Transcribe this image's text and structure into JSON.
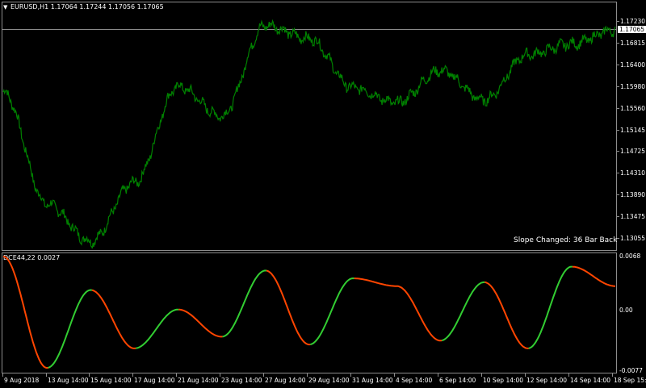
{
  "symbol_header": {
    "arrow": "▼",
    "text": "EURUSD,H1  1.17064 1.17244 1.17056 1.17065"
  },
  "current_price": "1.17065",
  "price_axis": [
    "1.17230",
    "1.16815",
    "1.16400",
    "1.15980",
    "1.15560",
    "1.15145",
    "1.14725",
    "1.14310",
    "1.13890",
    "1.13475",
    "1.13055"
  ],
  "annotation": "Slope Changed: 36 Bar Back",
  "indicator": {
    "header": "DCE44,22 0.0027",
    "axis": [
      "0.0068",
      "0.00",
      "-0.0077"
    ],
    "colors": {
      "rising": "#32cd32",
      "falling": "#ff4500"
    }
  },
  "time_axis": [
    "9 Aug 2018",
    "13 Aug 14:00",
    "15 Aug 14:00",
    "17 Aug 14:00",
    "21 Aug 14:00",
    "23 Aug 14:00",
    "27 Aug 14:00",
    "29 Aug 14:00",
    "31 Aug 14:00",
    "4 Sep 14:00",
    "6 Sep 14:00",
    "10 Sep 14:00",
    "12 Sep 14:00",
    "14 Sep 14:00",
    "18 Sep 15:00"
  ],
  "colors": {
    "price_line": "#008000",
    "background": "#000000",
    "grid": "#8c8c8c"
  },
  "chart_data": {
    "type": "line",
    "symbol": "EURUSD",
    "timeframe": "H1",
    "x": [
      "9 Aug 2018",
      "13 Aug 14:00",
      "15 Aug 14:00",
      "17 Aug 14:00",
      "21 Aug 14:00",
      "23 Aug 14:00",
      "27 Aug 14:00",
      "29 Aug 14:00",
      "31 Aug 14:00",
      "4 Sep 14:00",
      "6 Sep 14:00",
      "10 Sep 14:00",
      "12 Sep 14:00",
      "14 Sep 14:00",
      "18 Sep 15:00"
    ],
    "series": [
      {
        "name": "EURUSD",
        "values": [
          1.159,
          1.138,
          1.131,
          1.142,
          1.16,
          1.1545,
          1.1715,
          1.169,
          1.1598,
          1.157,
          1.163,
          1.1575,
          1.166,
          1.168,
          1.1706
        ]
      },
      {
        "name": "DCE44,22",
        "values": [
          0.0068,
          -0.0075,
          0.0025,
          -0.005,
          0.0,
          -0.0035,
          0.005,
          -0.0045,
          0.004,
          0.003,
          -0.004,
          0.0035,
          -0.005,
          0.0055,
          0.003
        ]
      }
    ],
    "ylim_price": [
      1.13055,
      1.1723
    ],
    "ylim_indicator": [
      -0.0077,
      0.0068
    ]
  }
}
